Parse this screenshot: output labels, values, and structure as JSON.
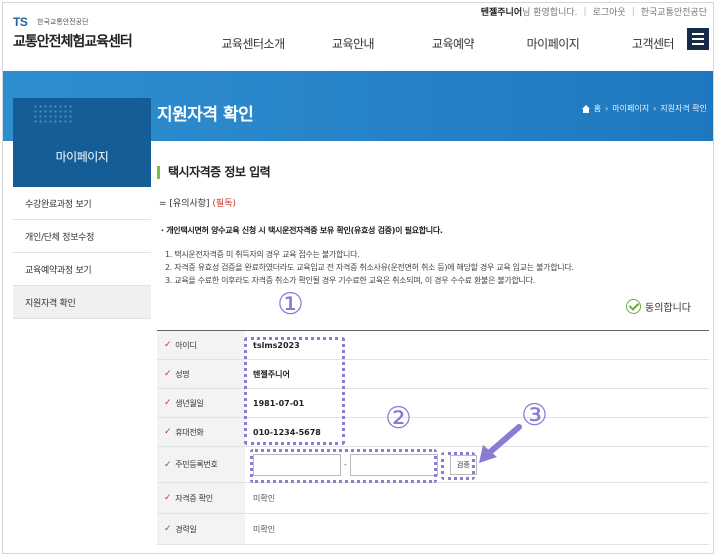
{
  "header": {
    "logo_mark": "TS",
    "logo_org": "한국교통안전공단",
    "site_title": "교통안전체험교육센터",
    "welcome_name": "텐젤주니어",
    "welcome_suffix": "님 환영합니다.",
    "logout": "로그아웃",
    "org_link": "한국교통안전공단",
    "nav": [
      "교육센터소개",
      "교육안내",
      "교육예약",
      "마이페이지",
      "고객센터"
    ]
  },
  "band": {
    "page_title": "지원자격 확인",
    "breadcrumb": [
      "홈",
      "마이페이지",
      "지원자격 확인"
    ]
  },
  "sidebar": {
    "title": "마이페이지",
    "items": [
      {
        "label": "수강완료과정 보기"
      },
      {
        "label": "개인/단체 정보수정"
      },
      {
        "label": "교육예약과정 보기"
      },
      {
        "label": "지원자격 확인"
      }
    ]
  },
  "content": {
    "section_title": "택시자격증 정보 입력",
    "notice_heading": "= [유의사항]",
    "notice_required": "(필독)",
    "notice_main": "· 개인택시면허 양수교육 신청 시 택시운전자격증 보유 확인(유효성 검증)이 필요합니다.",
    "notices": [
      "1. 택시운전자격증 미 취득자의 경우 교육 접수는 불가합니다.",
      "2. 자격증 유효성 검증을 완료하였더라도 교육입교 전 자격증 취소사유(운전면허 취소 등)에 해당할 경우 교육 입교는 불가합니다.",
      "3. 교육을 수료한 이후라도 자격증 취소가 확인될 경우 기수료한 교육은 취소되며, 이 경우 수수료 환불은 불가합니다."
    ],
    "agree_label": "동의합니다"
  },
  "form": {
    "id_label": "아이디",
    "id_value": "tslms2023",
    "name_label": "성명",
    "name_value": "텐젤주니어",
    "birth_label": "생년월일",
    "birth_value": "1981-07-01",
    "phone_label": "휴대전화",
    "phone_value": "010-1234-5678",
    "rrn_label": "주민등록번호",
    "rrn_separator": "-",
    "verify_button": "검증",
    "license_label": "자격증 확인",
    "license_value": "미확인",
    "career_label": "경력일",
    "career_value": "미확인"
  },
  "annotations": {
    "one": "①",
    "two": "②",
    "three": "③"
  },
  "colors": {
    "band": "#1f78bf",
    "sidebar_head": "#155d96",
    "annotation": "#8b7bd4",
    "accent_green": "#7bbf3a",
    "required_red": "#c0392b"
  }
}
